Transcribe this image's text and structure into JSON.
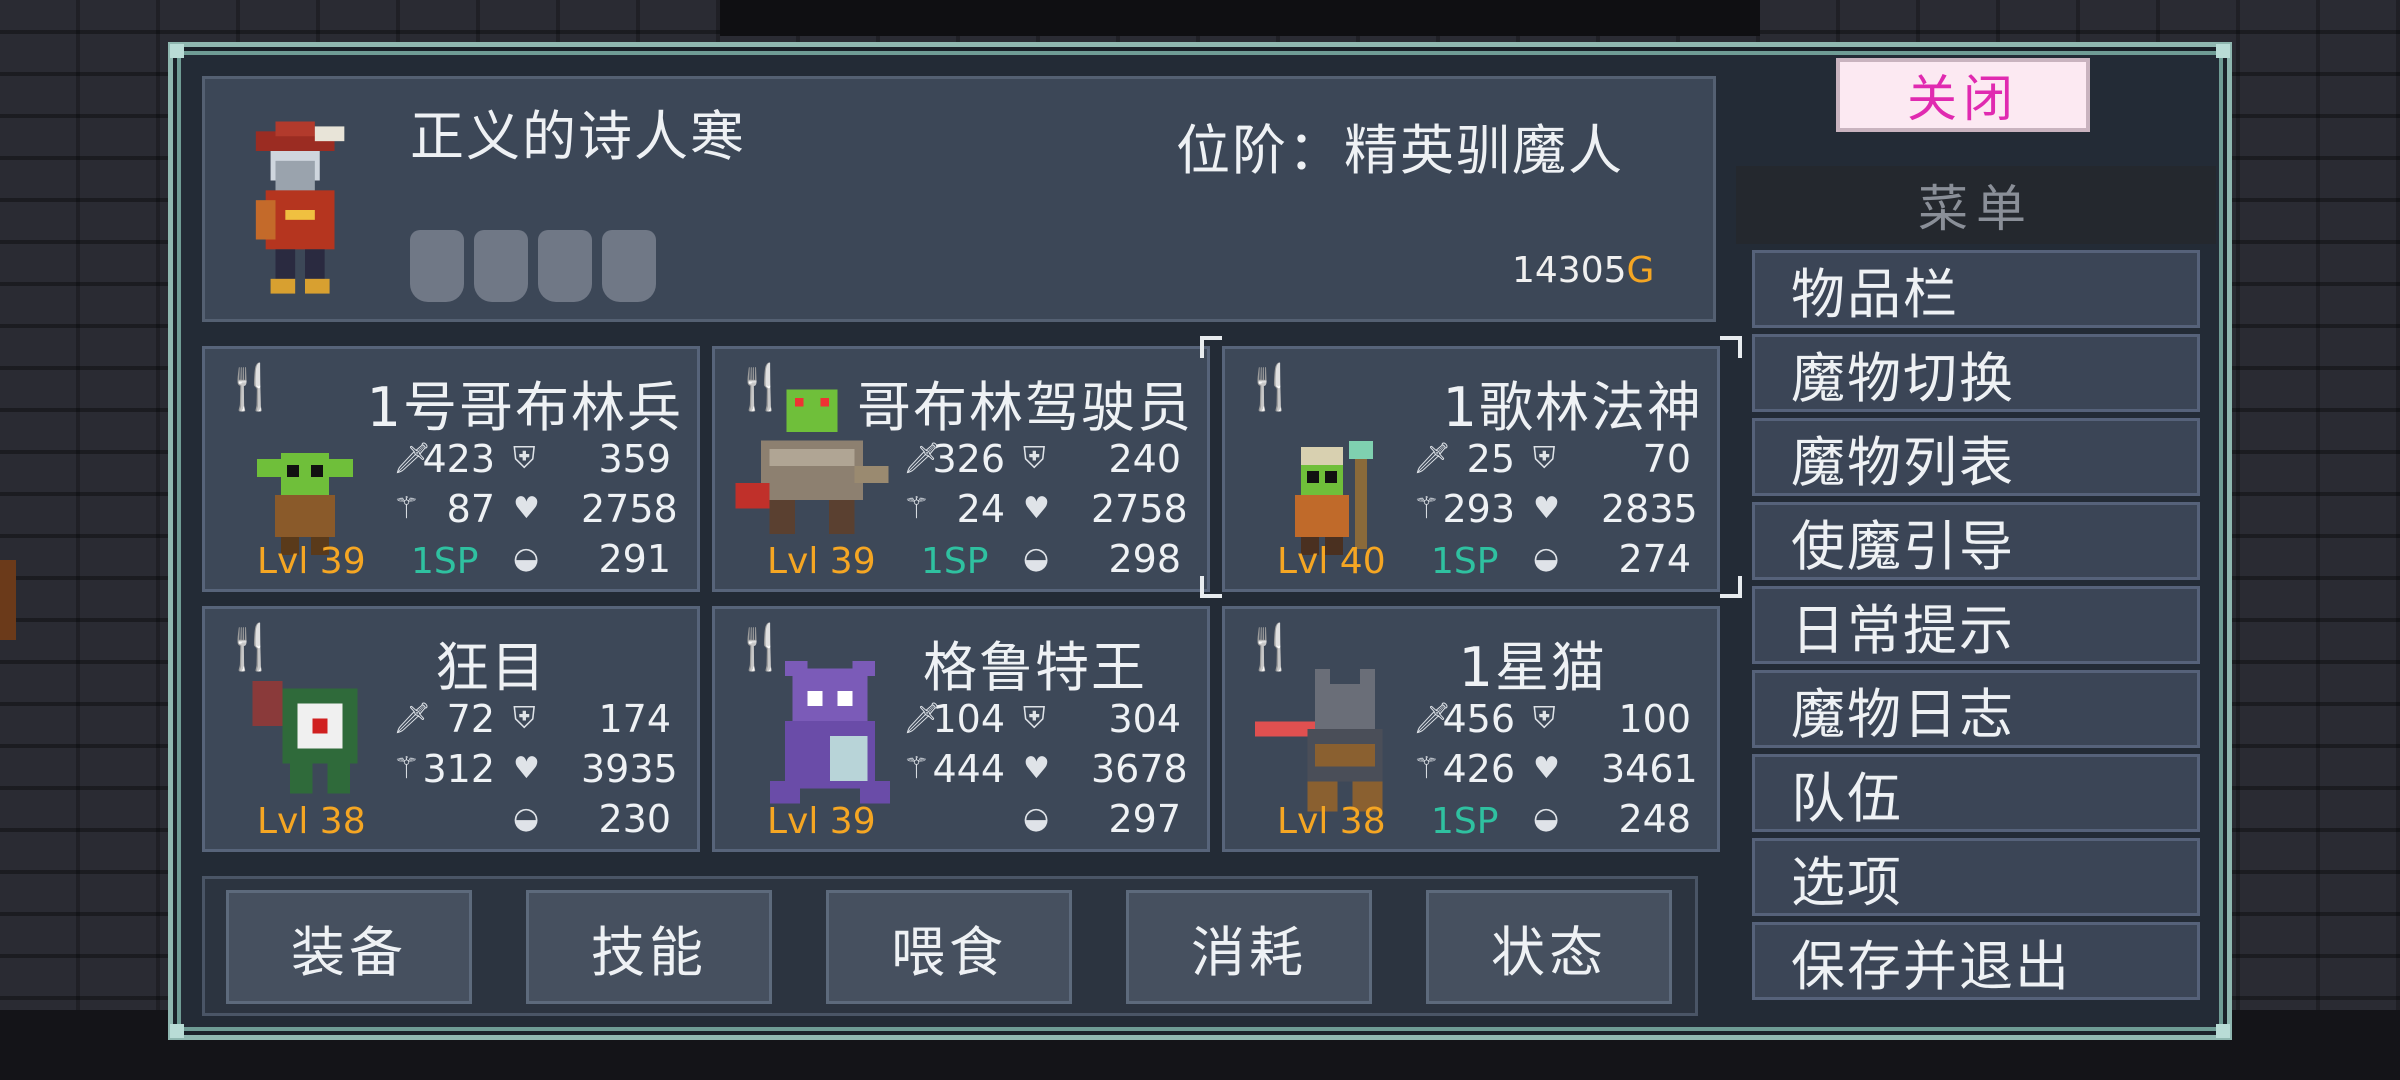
{
  "player": {
    "name": "正义的诗人寒",
    "rank": "位阶：精英驯魔人",
    "gold_amount": "14305",
    "gold_unit": "G"
  },
  "monsters": [
    {
      "name": "1号哥布林兵",
      "atk": "423",
      "def": "359",
      "mag": "87",
      "hp": "2758",
      "food": "291",
      "level": "Lvl 39",
      "sp": "1SP"
    },
    {
      "name": "哥布林驾驶员",
      "atk": "326",
      "def": "240",
      "mag": "24",
      "hp": "2758",
      "food": "298",
      "level": "Lvl 39",
      "sp": "1SP"
    },
    {
      "name": "1歌林法神",
      "atk": "25",
      "def": "70",
      "mag": "293",
      "hp": "2835",
      "food": "274",
      "level": "Lvl 40",
      "sp": "1SP"
    },
    {
      "name": "狂目",
      "atk": "72",
      "def": "174",
      "mag": "312",
      "hp": "3935",
      "food": "230",
      "level": "Lvl 38",
      "sp": ""
    },
    {
      "name": "格鲁特王",
      "atk": "104",
      "def": "304",
      "mag": "444",
      "hp": "3678",
      "food": "297",
      "level": "Lvl 39",
      "sp": ""
    },
    {
      "name": "1星猫",
      "atk": "456",
      "def": "100",
      "mag": "426",
      "hp": "3461",
      "food": "248",
      "level": "Lvl 38",
      "sp": "1SP"
    }
  ],
  "actions": [
    "装备",
    "技能",
    "喂食",
    "消耗",
    "状态"
  ],
  "menu": {
    "close_label": "关闭",
    "title": "菜单",
    "items": [
      "物品栏",
      "魔物切换",
      "魔物列表",
      "使魔引导",
      "日常提示",
      "魔物日志",
      "队伍",
      "选项",
      "保存并退出"
    ]
  },
  "colors": {
    "level": "#f5a623",
    "sp": "#2fc1a0",
    "close_text": "#e02ab0",
    "gold_unit": "#f5a623"
  }
}
